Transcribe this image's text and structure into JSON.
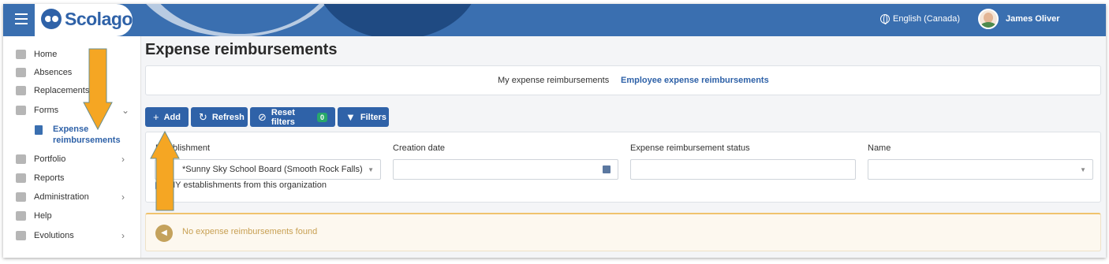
{
  "app": {
    "name": "Scolago",
    "language": "English (Canada)",
    "user": "James Oliver"
  },
  "sidebar": {
    "items": [
      {
        "label": "Home",
        "icon": "home-icon"
      },
      {
        "label": "Absences",
        "icon": "absences-icon"
      },
      {
        "label": "Replacements",
        "icon": "replacements-icon"
      },
      {
        "label": "Forms",
        "icon": "forms-icon"
      },
      {
        "label": "Portfolio",
        "icon": "trophy-icon"
      },
      {
        "label": "Reports",
        "icon": "reports-icon"
      },
      {
        "label": "Administration",
        "icon": "gear-icon"
      },
      {
        "label": "Help",
        "icon": "help-icon"
      },
      {
        "label": "Evolutions",
        "icon": "sprout-icon"
      }
    ],
    "active_sub": "Expense reimbursements"
  },
  "page": {
    "title": "Expense reimbursements"
  },
  "tabs": [
    "My expense reimbursements",
    "Employee expense reimbursements"
  ],
  "toolbar": {
    "add": "Add",
    "refresh": "Refresh",
    "reset": "Reset filters",
    "reset_count": "0",
    "filters": "Filters"
  },
  "filters": {
    "establishment_label": "Establishment",
    "establishment_value": "*Sunny Sky School Board (Smooth Rock Falls)",
    "creation_date_label": "Creation date",
    "status_label": "Expense reimbursement status",
    "name_label": "Name",
    "checkbox_label": "MY establishments from this organization"
  },
  "alert": {
    "text": "No expense reimbursements found"
  },
  "colors": {
    "primary": "#2f62a8",
    "topbar": "#3a6fb0",
    "arrow": "#f5a623",
    "alert": "#c8a053"
  }
}
